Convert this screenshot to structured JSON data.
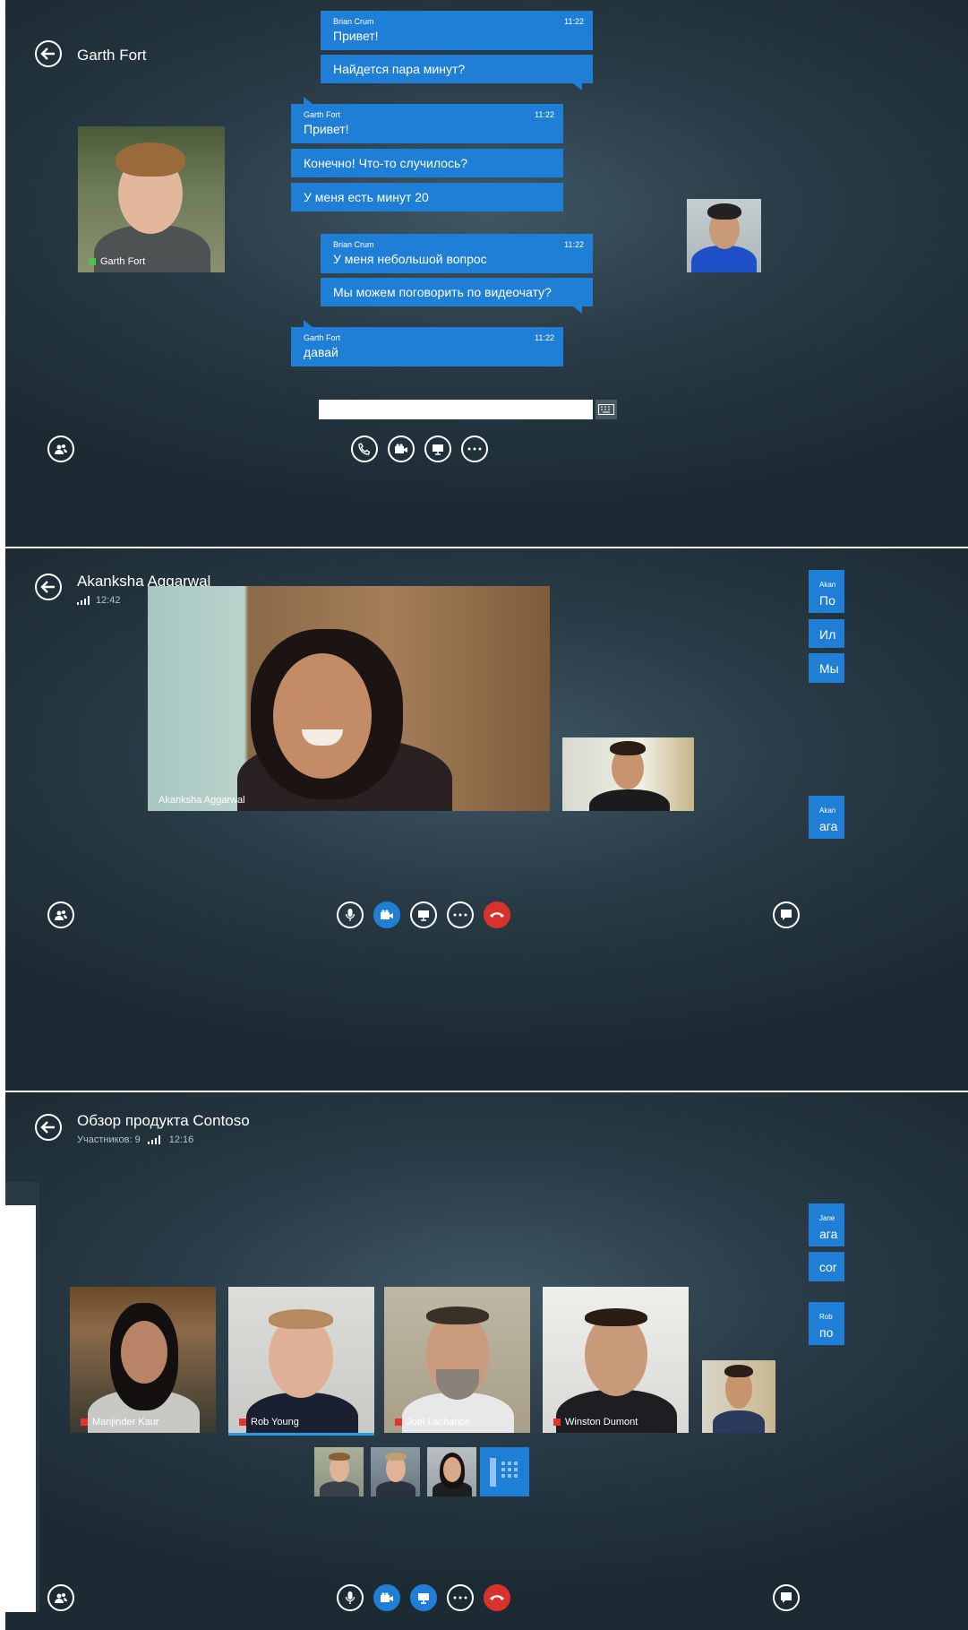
{
  "colors": {
    "accent": "#1f7fd6",
    "end_call": "#d7322b",
    "presence_green": "#4cc44c",
    "presence_red": "#e2342b"
  },
  "screen1": {
    "title": "Garth Fort",
    "messages": [
      {
        "sender": "Brian Crum",
        "time": "11:22",
        "text": "Привет!"
      },
      {
        "text": "Найдется пара минут?"
      },
      {
        "sender": "Garth Fort",
        "time": "11:22",
        "text": "Привет!"
      },
      {
        "text": "Конечно! Что-то случилось?"
      },
      {
        "text": "У меня есть минут 20"
      },
      {
        "sender": "Brian Crum",
        "time": "11:22",
        "text": "У меня небольшой вопрос"
      },
      {
        "text": "Мы можем поговорить по видеочату?"
      },
      {
        "sender": "Garth Fort",
        "time": "11:22",
        "text": "давай"
      }
    ],
    "contact_label": "Garth Fort",
    "message_input_value": "",
    "controls": [
      "participants-icon",
      "phone-icon",
      "video-icon",
      "present-icon",
      "more-icon",
      "keyboard-icon"
    ]
  },
  "screen2": {
    "title": "Akanksha Aggarwal",
    "time": "12:42",
    "video_label": "Akanksha Aggarwal",
    "side_chat": [
      "Akan",
      "По",
      "Ил",
      "Мы",
      "Akan",
      "ага"
    ],
    "controls": [
      "participants-icon",
      "mic-icon",
      "video-icon",
      "present-icon",
      "more-icon",
      "end-call-icon",
      "chat-icon"
    ]
  },
  "screen3": {
    "title": "Обзор продукта Contoso",
    "participants_label": "Участников: 9",
    "time": "12:16",
    "tiles": [
      {
        "name": "Manjinder Kaur"
      },
      {
        "name": "Rob Young"
      },
      {
        "name": "Joel Lachance"
      },
      {
        "name": "Winston Dumont"
      }
    ],
    "side_chat": [
      "Jane",
      "ага",
      "cor",
      "Rob",
      "по"
    ],
    "controls": [
      "participants-icon",
      "mic-icon",
      "video-icon",
      "present-icon",
      "more-icon",
      "end-call-icon",
      "chat-icon"
    ]
  }
}
